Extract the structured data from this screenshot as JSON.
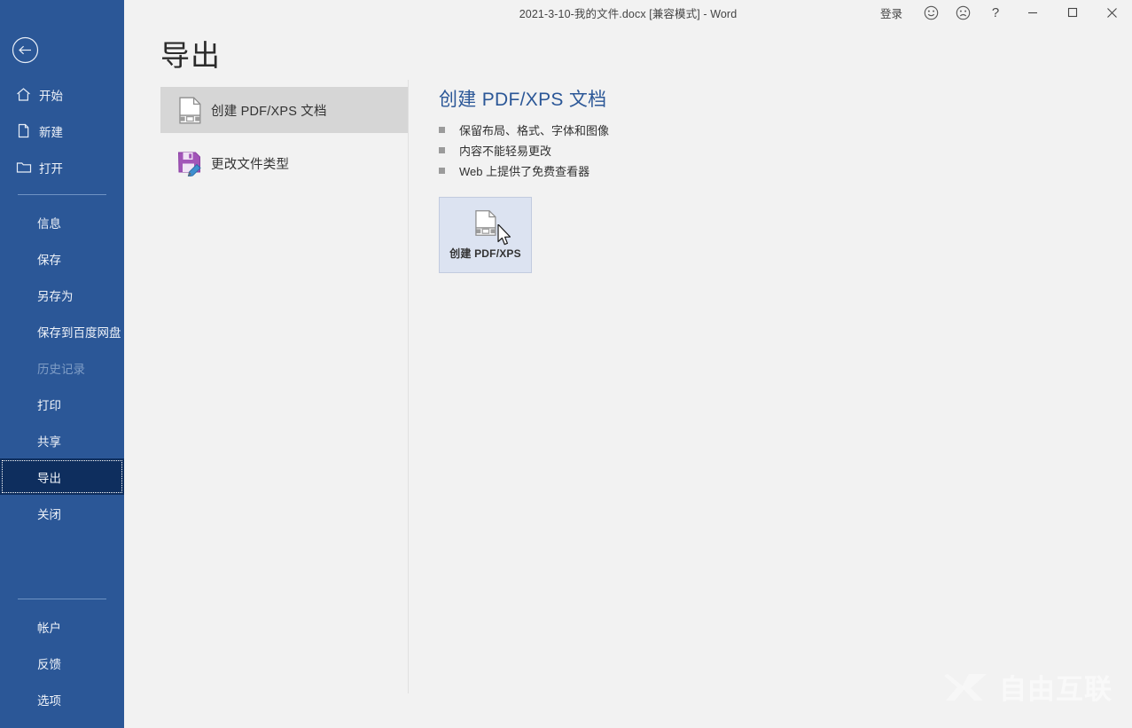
{
  "titlebar": {
    "document_title": "2021-3-10-我的文件.docx [兼容模式]  -  Word",
    "signin_label": "登录",
    "smiley_icon": "smiley-face-icon",
    "frowny_icon": "frowny-face-icon",
    "help_label": "?",
    "minimize_label": "—",
    "maximize_label": "□",
    "close_label": "✕"
  },
  "rail": {
    "back_icon": "back-arrow-icon",
    "top_items": [
      {
        "label": "开始",
        "icon": "home-icon"
      },
      {
        "label": "新建",
        "icon": "new-document-icon"
      },
      {
        "label": "打开",
        "icon": "open-folder-icon"
      }
    ],
    "items": [
      {
        "label": "信息",
        "state": "normal"
      },
      {
        "label": "保存",
        "state": "normal"
      },
      {
        "label": "另存为",
        "state": "normal"
      },
      {
        "label": "保存到百度网盘",
        "state": "normal"
      },
      {
        "label": "历史记录",
        "state": "disabled"
      },
      {
        "label": "打印",
        "state": "normal"
      },
      {
        "label": "共享",
        "state": "normal"
      },
      {
        "label": "导出",
        "state": "active"
      },
      {
        "label": "关闭",
        "state": "normal"
      }
    ],
    "bottom_items": [
      {
        "label": "帐户"
      },
      {
        "label": "反馈"
      },
      {
        "label": "选项"
      }
    ]
  },
  "page": {
    "title": "导出"
  },
  "middle": {
    "items": [
      {
        "label": "创建 PDF/XPS 文档",
        "icon": "pdf-document-icon",
        "selected": true
      },
      {
        "label": "更改文件类型",
        "icon": "save-pencil-icon",
        "selected": false
      }
    ]
  },
  "detail": {
    "title": "创建 PDF/XPS 文档",
    "bullets": [
      "保留布局、格式、字体和图像",
      "内容不能轻易更改",
      "Web 上提供了免费查看器"
    ],
    "action_button": {
      "label": "创建 PDF/XPS",
      "icon": "pdf-document-icon"
    }
  },
  "watermark": {
    "text": "自由互联",
    "logo_icon": "x-logo-icon"
  },
  "colors": {
    "rail_blue": "#2b5797",
    "rail_active": "#0e2e5e",
    "accent_text": "#2b5797",
    "selected_row": "#d6d6d6",
    "button_hover": "#dce3f1",
    "page_bg": "#f2f2f2"
  }
}
